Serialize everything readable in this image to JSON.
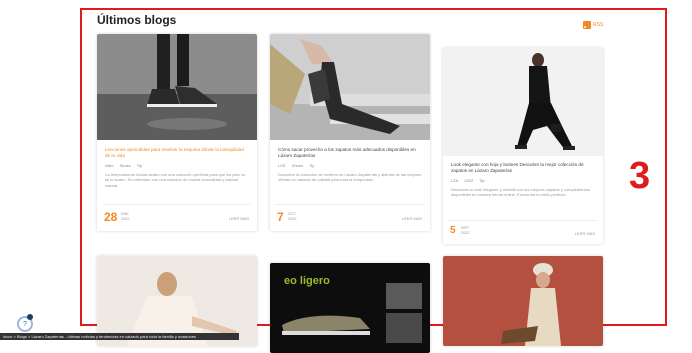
{
  "section": {
    "title": "Últimos blogs",
    "rss_label": "RSS",
    "annotation_number": "3"
  },
  "cards": [
    {
      "title": "Lecciones aprendidas para resolver la esquina dónde la tranquilidad de tu vida",
      "meta": [
        "Nitro",
        "Shoes",
        "Tip"
      ],
      "excerpt": "La temporada de lluvias acabó con una colección perfecta para que los pies no se lo suden. Se enfrentan con una solución de mucha comodidad y calidad natural.",
      "day": "28",
      "month": "ENE",
      "year": "2022",
      "read_more": "LEER MÁS"
    },
    {
      "title": "Cómo sacar provecho a los zapatos más adecuados disponibles en Lázaro Zapaterías",
      "meta": [
        "LCE",
        "Shoes",
        "Tip"
      ],
      "excerpt": "Descubre la colección de invierno en Lázaro Zapaterías y disfruta de las mejores ofertas en calzado de calidad para toda la temporada.",
      "day": "7",
      "month": "OCT",
      "year": "2022",
      "read_more": "LEER MÁS"
    },
    {
      "title": "Look elegante con hoja y botines Descubre la mejor colección de zapatos en Lázaro Zapaterías",
      "meta": [
        "LZA",
        "2022",
        "Tip"
      ],
      "excerpt": "Descubre un look elegante y versátil con los mejores zapatos y complementos disponibles en nuestra tienda online. Encuentra tu estilo perfecto.",
      "day": "5",
      "month": "SEP",
      "year": "2022",
      "read_more": "LEER MÁS"
    }
  ],
  "bottom_cards": [
    {
      "logo_text": "eo ligero"
    }
  ],
  "status_text": "Inicio > Blogs > Lázaro Zapaterías - últimas noticias y tendencias en calzado para toda la familia y ocasiones",
  "help_icon": "?"
}
